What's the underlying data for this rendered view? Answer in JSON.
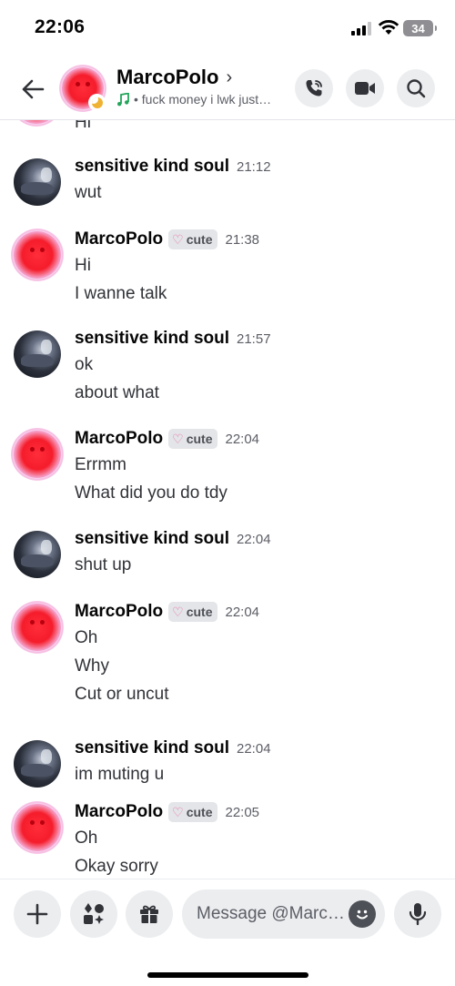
{
  "status_bar": {
    "time": "22:06",
    "battery": "34"
  },
  "header": {
    "name": "MarcoPolo",
    "chevron": "›",
    "activity_icon": "music-note-icon",
    "activity": "• fuck money i lwk just…",
    "status": "idle"
  },
  "partial_message": {
    "text": "Hi"
  },
  "messages": [
    {
      "author": "sensitive kind soul",
      "avatar": "soul",
      "tag": "",
      "time": "21:12",
      "lines": [
        "wut"
      ]
    },
    {
      "author": "MarcoPolo",
      "avatar": "marco",
      "tag": "cute",
      "time": "21:38",
      "lines": [
        "Hi",
        "I wanne talk"
      ]
    },
    {
      "author": "sensitive kind soul",
      "avatar": "soul",
      "tag": "",
      "time": "21:57",
      "lines": [
        "ok",
        "about what"
      ]
    },
    {
      "author": "MarcoPolo",
      "avatar": "marco",
      "tag": "cute",
      "time": "22:04",
      "lines": [
        "Errmm",
        "What did you do tdy"
      ]
    },
    {
      "author": "sensitive kind soul",
      "avatar": "soul",
      "tag": "",
      "time": "22:04",
      "lines": [
        "shut up"
      ]
    },
    {
      "author": "MarcoPolo",
      "avatar": "marco",
      "tag": "cute",
      "time": "22:04",
      "lines": [
        "Oh",
        "Why",
        "Cut or uncut"
      ]
    },
    {
      "author": "sensitive kind soul",
      "avatar": "soul",
      "tag": "",
      "time": "22:04",
      "lines": [
        "im muting u"
      ]
    },
    {
      "author": "MarcoPolo",
      "avatar": "marco",
      "tag": "cute",
      "time": "22:05",
      "lines": [
        "Oh",
        "Okay sorry"
      ]
    }
  ],
  "composer": {
    "placeholder": "Message @Marc…"
  },
  "colors": {
    "accent_green": "#23a55a",
    "idle_yellow": "#f0b232",
    "tag_heart": "#eb6fa7"
  }
}
